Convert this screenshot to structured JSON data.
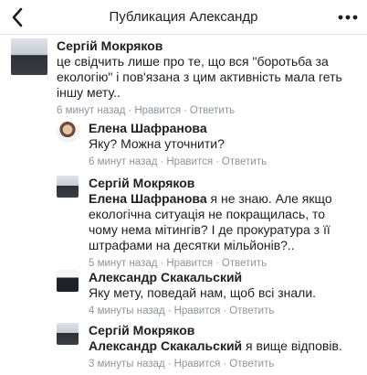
{
  "header": {
    "title": "Публикация Александр"
  },
  "comments": [
    {
      "author": "Сергій Мокряков",
      "mention": "",
      "text": "це свідчить лише про те, що вся \"боротьба за екологію\" і пов'язана з цим активність мала геть іншу мету..",
      "time": "6 минут назад",
      "like": "Нравится",
      "reply": "Ответить"
    },
    {
      "author": "Елена Шафранова",
      "mention": "",
      "text": "Яку? Можна уточнити?",
      "time": "6 минут назад",
      "like": "Нравится",
      "reply": "Ответить"
    },
    {
      "author": "Сергій Мокряков",
      "mention": "Елена Шафранова",
      "text": " я не знаю. Але якщо екологічна ситуація не покращилась, то чому нема мітингів? І де прокуратура з її штрафами на десятки мільйонів?..",
      "time": "5 минут назад",
      "like": "Нравится",
      "reply": "Ответить"
    },
    {
      "author": "Александр Скакальский",
      "mention": "",
      "text": "Яку мету, поведай нам, щоб всі знали.",
      "time": "4 минуты назад",
      "like": "Нравится",
      "reply": "Ответить"
    },
    {
      "author": "Сергій Мокряков",
      "mention": "Александр Скакальский",
      "text": " я вище відповів.",
      "time": "3 минуты назад",
      "like": "Нравится",
      "reply": "Ответить"
    }
  ]
}
